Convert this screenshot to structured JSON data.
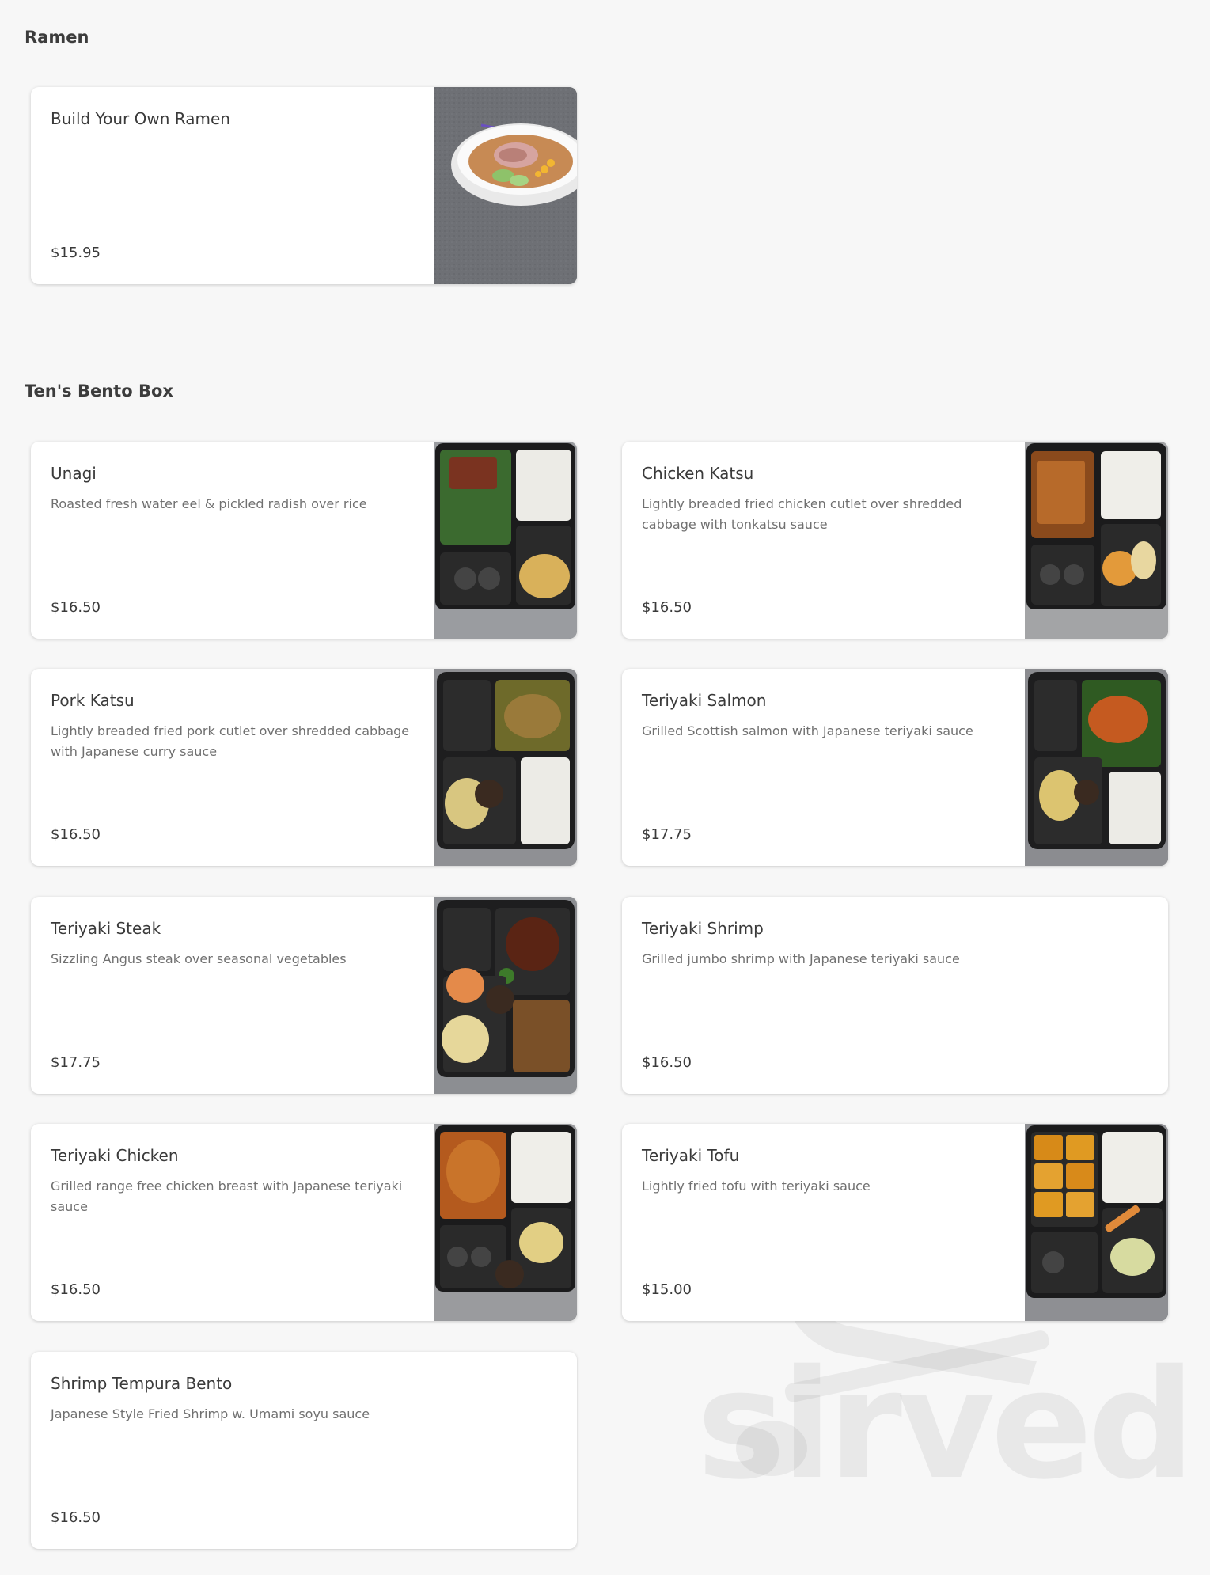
{
  "sections": [
    {
      "title": "Ramen",
      "items": [
        {
          "name": "Build Your Own Ramen",
          "description": "",
          "price": "$15.95",
          "image": "ramen-bowl-photo"
        }
      ]
    },
    {
      "title": "Ten's Bento Box",
      "items": [
        {
          "name": "Unagi",
          "description": "Roasted fresh water eel & pickled radish over rice",
          "price": "$16.50",
          "image": "bento-box-photo"
        },
        {
          "name": "Chicken Katsu",
          "description": "Lightly breaded fried chicken cutlet over shredded cabbage with tonkatsu sauce",
          "price": "$16.50",
          "image": "bento-box-photo"
        },
        {
          "name": "Pork Katsu",
          "description": "Lightly breaded fried pork cutlet over shredded cabbage with Japanese curry sauce",
          "price": "$16.50",
          "image": "bento-box-photo"
        },
        {
          "name": "Teriyaki Salmon",
          "description": "Grilled Scottish salmon with Japanese teriyaki sauce",
          "price": "$17.75",
          "image": "bento-box-photo"
        },
        {
          "name": "Teriyaki Steak",
          "description": "Sizzling Angus steak over seasonal vegetables",
          "price": "$17.75",
          "image": "bento-box-photo"
        },
        {
          "name": "Teriyaki Shrimp",
          "description": "Grilled jumbo shrimp with Japanese teriyaki sauce",
          "price": "$16.50",
          "image": ""
        },
        {
          "name": "Teriyaki Chicken",
          "description": "Grilled range free chicken breast with Japanese teriyaki sauce",
          "price": "$16.50",
          "image": "bento-box-photo"
        },
        {
          "name": "Teriyaki Tofu",
          "description": "Lightly fried tofu with teriyaki sauce",
          "price": "$15.00",
          "image": "bento-box-photo"
        },
        {
          "name": "Shrimp Tempura Bento",
          "description": "Japanese Style Fried Shrimp w. Umami soyu sauce",
          "price": "$16.50",
          "image": ""
        }
      ]
    }
  ],
  "watermark": {
    "text": "sirved",
    "icon": "fork-spoon-icon"
  },
  "colors": {
    "background": "#f7f7f7",
    "card": "#ffffff",
    "title": "#3c3c3c",
    "description": "#707070"
  }
}
